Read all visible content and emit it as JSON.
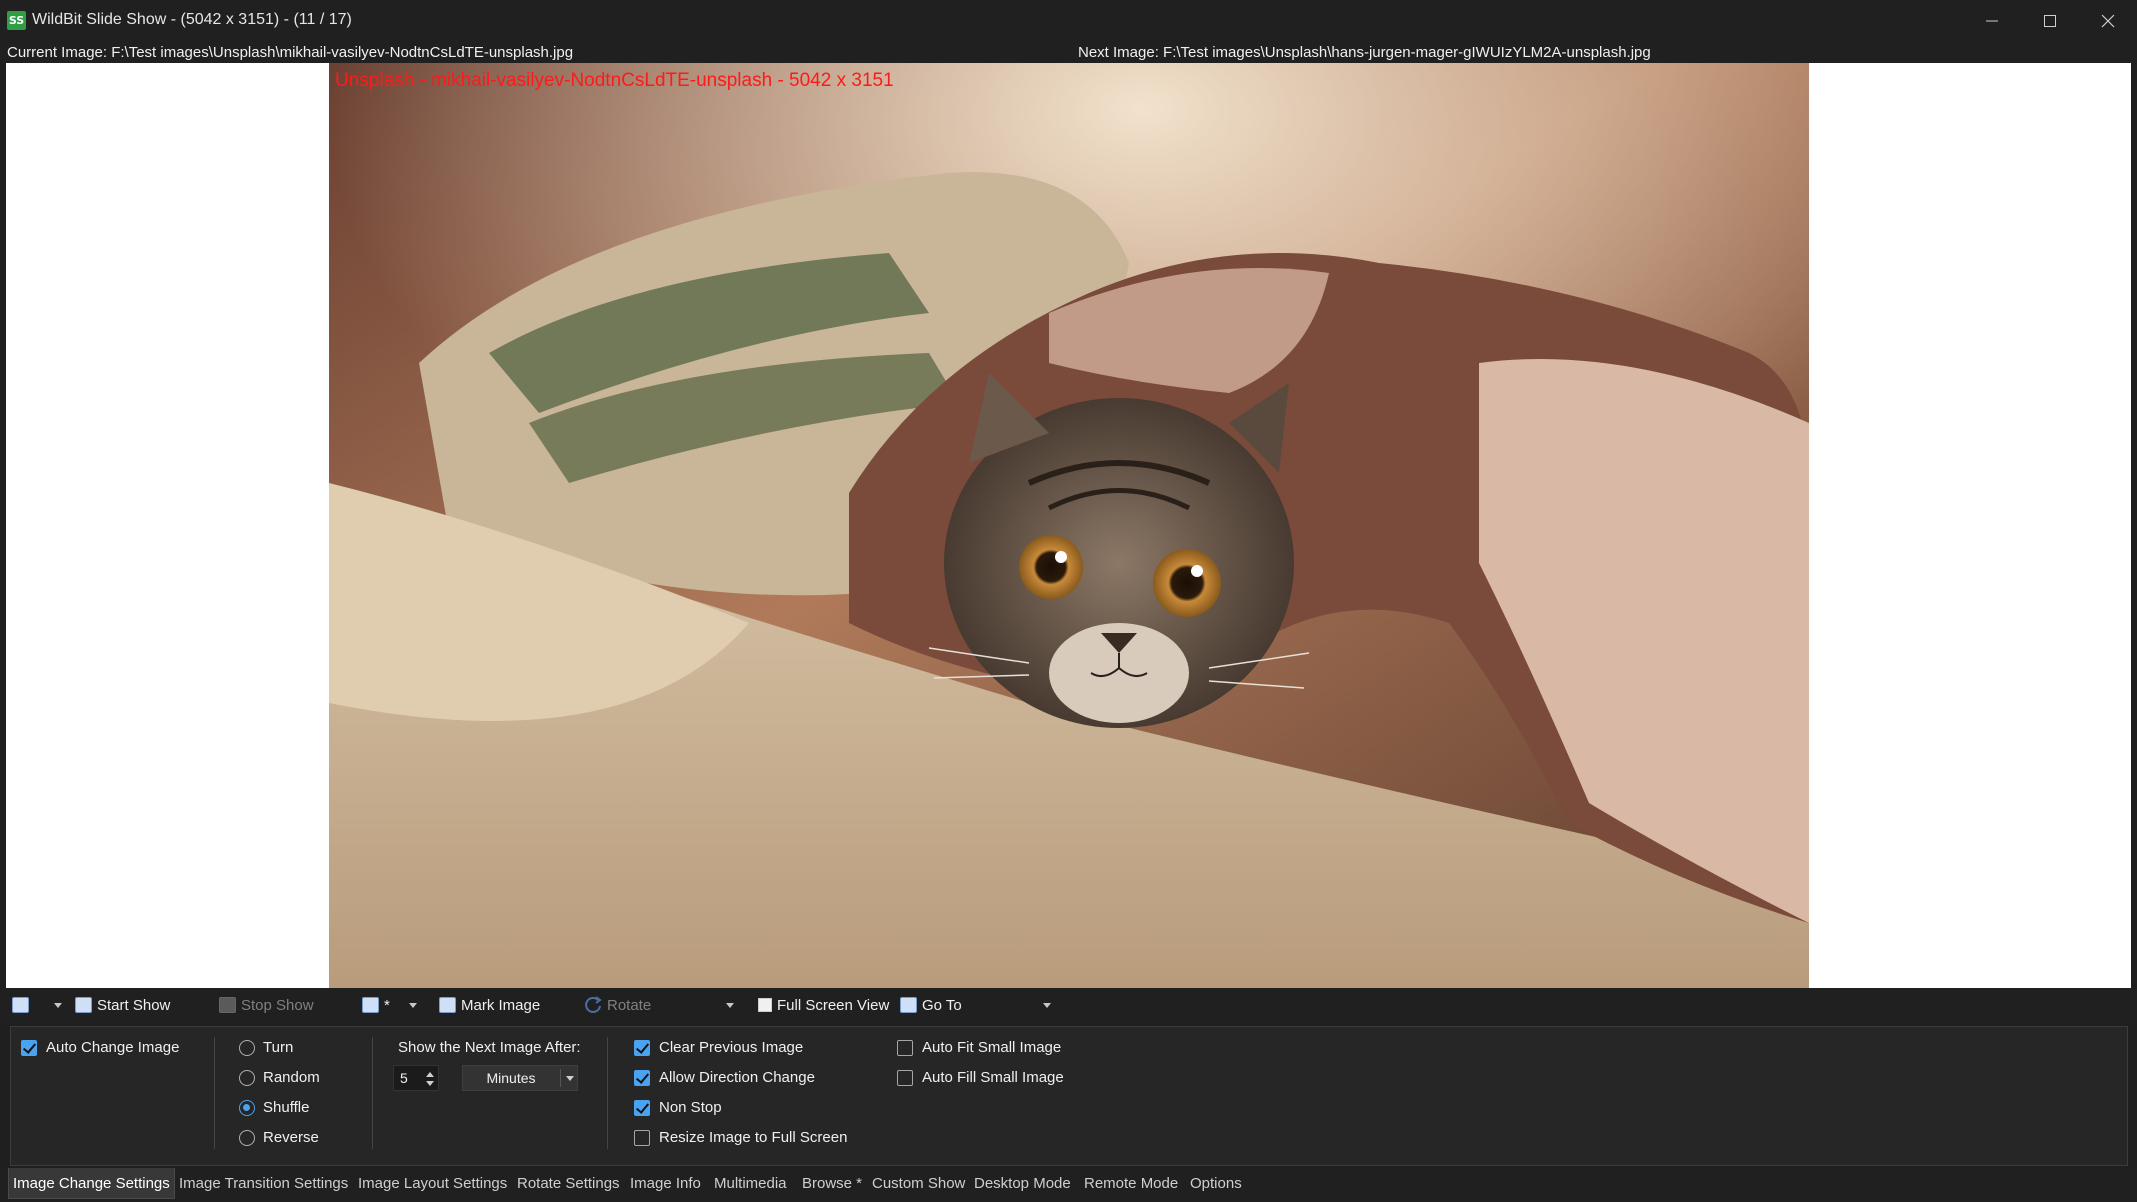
{
  "window": {
    "title": "WildBit Slide Show - (5042 x 3151) - (11 / 17)",
    "app_icon": "SS"
  },
  "info": {
    "current_image": "Current Image: F:\\Test images\\Unsplash\\mikhail-vasilyev-NodtnCsLdTE-unsplash.jpg",
    "next_image": "Next Image: F:\\Test images\\Unsplash\\hans-jurgen-mager-gIWUIzYLM2A-unsplash.jpg"
  },
  "viewer": {
    "overlay": "Unsplash - mikhail-vasilyev-NodtnCsLdTE-unsplash - 5042 x 3151",
    "overlay_color": "#ff1a1a",
    "photo_subject": "kitten-under-blanket-photo"
  },
  "toolbar": {
    "start_show": "Start Show",
    "stop_show": "Stop Show",
    "star": "*",
    "mark_image": "Mark Image",
    "rotate": "Rotate",
    "full_screen_view": "Full Screen View",
    "go_to": "Go To"
  },
  "settings": {
    "auto_change_image": {
      "label": "Auto Change Image",
      "checked": true
    },
    "order": {
      "options": [
        "Turn",
        "Random",
        "Shuffle",
        "Reverse"
      ],
      "selected": "Shuffle"
    },
    "show_next_after_label": "Show the Next Image After:",
    "interval_value": "5",
    "interval_unit": "Minutes",
    "clear_previous_image": {
      "label": "Clear Previous Image",
      "checked": true
    },
    "allow_direction_change": {
      "label": "Allow Direction Change",
      "checked": true
    },
    "non_stop": {
      "label": "Non Stop",
      "checked": true
    },
    "resize_to_full_screen": {
      "label": "Resize Image to Full Screen",
      "checked": false
    },
    "auto_fit_small_image": {
      "label": "Auto Fit Small Image",
      "checked": false
    },
    "auto_fill_small_image": {
      "label": "Auto Fill Small Image",
      "checked": false
    }
  },
  "tabs": [
    "Image Change Settings",
    "Image Transition Settings",
    "Image Layout Settings",
    "Rotate Settings",
    "Image Info",
    "Multimedia",
    "Browse *",
    "Custom Show",
    "Desktop Mode",
    "Remote Mode",
    "Options"
  ],
  "active_tab": "Image Change Settings",
  "colors": {
    "accent": "#4aa3f0",
    "background": "#202020"
  }
}
